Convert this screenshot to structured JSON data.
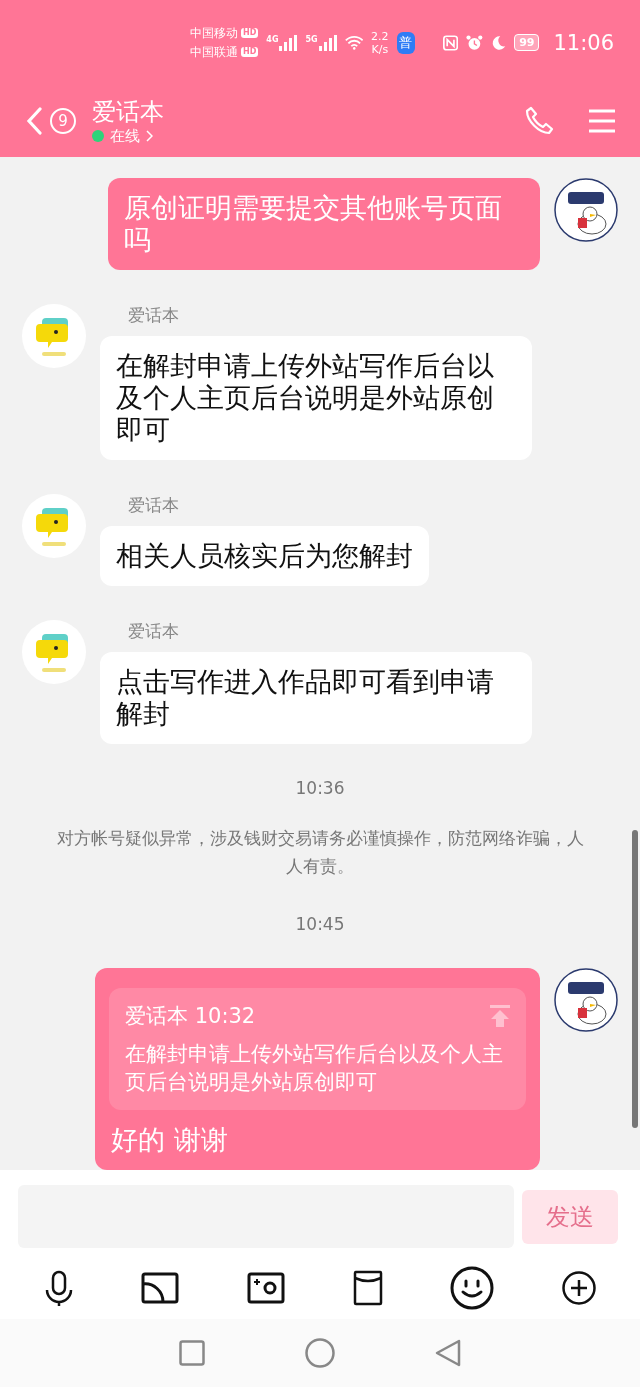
{
  "status_bar": {
    "carriers": [
      {
        "name": "中国移动",
        "badge": "HD"
      },
      {
        "name": "中国联通",
        "badge": "HD"
      }
    ],
    "signals": [
      "4G",
      "5G"
    ],
    "speed": {
      "value": "2.2",
      "unit": "K/s"
    },
    "app_badge": "普",
    "battery": "99",
    "time": "11:06"
  },
  "header": {
    "unread": "9",
    "title": "爱话本",
    "online": true,
    "status": "在线"
  },
  "messages": [
    {
      "kind": "outgoing",
      "text": "原创证明需要提交其他账号页面吗"
    },
    {
      "kind": "incoming",
      "sender": "爱话本",
      "text": "在解封申请上传外站写作后台以及个人主页后台说明是外站原创即可"
    },
    {
      "kind": "incoming",
      "sender": "爱话本",
      "text": "相关人员核实后为您解封"
    },
    {
      "kind": "incoming",
      "sender": "爱话本",
      "text": "点击写作进入作品即可看到申请解封"
    },
    {
      "kind": "time",
      "text": "10:36"
    },
    {
      "kind": "notice",
      "text": "对方帐号疑似异常，涉及钱财交易请务必谨慎操作，防范网络诈骗，人人有责。"
    },
    {
      "kind": "time",
      "text": "10:45"
    },
    {
      "kind": "outgoing",
      "quote": {
        "header": "爱话本 10:32",
        "text": "在解封申请上传外站写作后台以及个人主页后台说明是外站原创即可"
      },
      "text": "好的 谢谢"
    }
  ],
  "composer": {
    "send": "发送",
    "send_disabled": true
  }
}
